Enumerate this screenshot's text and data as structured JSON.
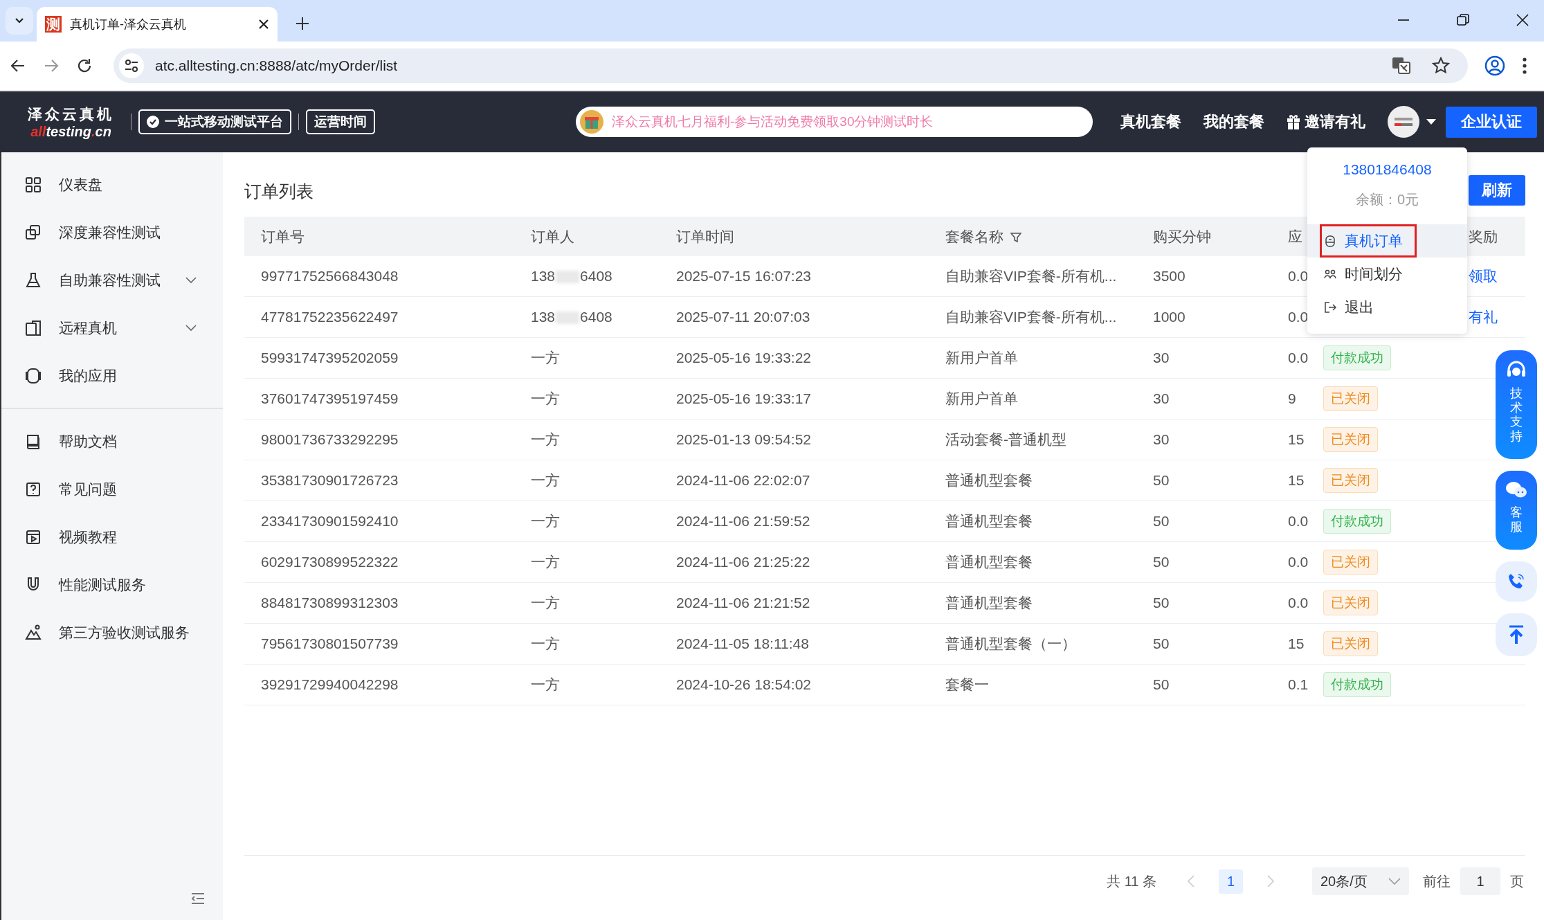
{
  "browser": {
    "tab": {
      "favicon_text": "测",
      "title": "真机订单-泽众云真机"
    },
    "url": "atc.alltesting.cn:8888/atc/myOrder/list"
  },
  "header": {
    "logo_name": "泽众云真机",
    "logo_domain": [
      {
        "text": "all",
        "color": "#e8312a"
      },
      {
        "text": "testing",
        "color": "#ffffff"
      },
      {
        "text": ".",
        "color": "#e8312a"
      },
      {
        "text": "cn",
        "color": "#ffffff"
      }
    ],
    "badges": [
      {
        "label": "一站式移动测试平台",
        "kind": "check"
      },
      {
        "label": "运营时间",
        "kind": "plain"
      }
    ],
    "announcement": "泽众云真机七月福利-参与活动免费领取30分钟测试时长",
    "nav": [
      {
        "label": "真机套餐",
        "kind": "text"
      },
      {
        "label": "我的套餐",
        "kind": "text"
      },
      {
        "label": "邀请有礼",
        "kind": "gift"
      }
    ],
    "cert_button": "企业认证"
  },
  "sidebar": {
    "groups": [
      [
        {
          "label": "仪表盘"
        },
        {
          "label": "深度兼容性测试"
        },
        {
          "label": "自助兼容性测试",
          "expanded": false
        },
        {
          "label": "远程真机",
          "expanded": false
        },
        {
          "label": "我的应用"
        }
      ],
      [
        {
          "label": "帮助文档"
        },
        {
          "label": "常见问题"
        },
        {
          "label": "视频教程"
        },
        {
          "label": "性能测试服务"
        },
        {
          "label": "第三方验收测试服务"
        }
      ]
    ]
  },
  "page": {
    "title": "订单列表",
    "refresh_button": "刷新"
  },
  "table": {
    "columns": [
      {
        "label": "订单号"
      },
      {
        "label": "订单人"
      },
      {
        "label": "订单时间"
      },
      {
        "label": "套餐名称",
        "filter": true
      },
      {
        "label": "购买分钟"
      },
      {
        "label": "应"
      },
      {
        "label": "奖励"
      }
    ],
    "rows": [
      {
        "order_no": "99771752566843048",
        "orderer": [
          "138",
          "6408"
        ],
        "time": "2025-07-15 16:07:23",
        "package": "自助兼容VIP套餐-所有机...",
        "minutes": "3500",
        "amount": "0.0",
        "reward": "领取"
      },
      {
        "order_no": "47781752235622497",
        "orderer": [
          "138",
          "6408"
        ],
        "time": "2025-07-11 20:07:03",
        "package": "自助兼容VIP套餐-所有机...",
        "minutes": "1000",
        "amount": "0.0",
        "reward": "有礼"
      },
      {
        "order_no": "59931747395202059",
        "orderer": [
          "一方"
        ],
        "time": "2025-05-16 19:33:22",
        "package": "新用户首单",
        "minutes": "30",
        "amount": "0.0",
        "status": {
          "text": "付款成功",
          "kind": "paid"
        }
      },
      {
        "order_no": "37601747395197459",
        "orderer": [
          "一方"
        ],
        "time": "2025-05-16 19:33:17",
        "package": "新用户首单",
        "minutes": "30",
        "amount": "9",
        "status": {
          "text": "已关闭",
          "kind": "closed"
        }
      },
      {
        "order_no": "98001736733292295",
        "orderer": [
          "一方"
        ],
        "time": "2025-01-13 09:54:52",
        "package": "活动套餐-普通机型",
        "minutes": "30",
        "amount": "15",
        "status": {
          "text": "已关闭",
          "kind": "closed"
        }
      },
      {
        "order_no": "35381730901726723",
        "orderer": [
          "一方"
        ],
        "time": "2024-11-06 22:02:07",
        "package": "普通机型套餐",
        "minutes": "50",
        "amount": "15",
        "status": {
          "text": "已关闭",
          "kind": "closed"
        }
      },
      {
        "order_no": "23341730901592410",
        "orderer": [
          "一方"
        ],
        "time": "2024-11-06 21:59:52",
        "package": "普通机型套餐",
        "minutes": "50",
        "amount": "0.0",
        "status": {
          "text": "付款成功",
          "kind": "paid"
        }
      },
      {
        "order_no": "60291730899522322",
        "orderer": [
          "一方"
        ],
        "time": "2024-11-06 21:25:22",
        "package": "普通机型套餐",
        "minutes": "50",
        "amount": "0.0",
        "status": {
          "text": "已关闭",
          "kind": "closed"
        }
      },
      {
        "order_no": "88481730899312303",
        "orderer": [
          "一方"
        ],
        "time": "2024-11-06 21:21:52",
        "package": "普通机型套餐",
        "minutes": "50",
        "amount": "0.0",
        "status": {
          "text": "已关闭",
          "kind": "closed"
        }
      },
      {
        "order_no": "79561730801507739",
        "orderer": [
          "一方"
        ],
        "time": "2024-11-05 18:11:48",
        "package": "普通机型套餐（一）",
        "minutes": "50",
        "amount": "15",
        "status": {
          "text": "已关闭",
          "kind": "closed"
        }
      },
      {
        "order_no": "39291729940042298",
        "orderer": [
          "一方"
        ],
        "time": "2024-10-26 18:54:02",
        "package": "套餐一",
        "minutes": "50",
        "amount": "0.1",
        "status": {
          "text": "付款成功",
          "kind": "paid"
        }
      }
    ]
  },
  "pagination": {
    "total": "共 11 条",
    "prev_disabled": true,
    "pages": [
      {
        "label": "1",
        "selected": true
      }
    ],
    "next_disabled": true,
    "page_size": "20条/页",
    "goto_label": "前往",
    "goto_value": "1",
    "goto_suffix": "页"
  },
  "user_menu": {
    "phone": "13801846408",
    "balance": "余额：0元",
    "items": [
      {
        "label": "真机订单",
        "selected": true,
        "outlined": true
      },
      {
        "label": "时间划分",
        "selected": false,
        "outlined": false
      },
      {
        "label": "退出",
        "selected": false,
        "outlined": false
      }
    ]
  },
  "float_tools": {
    "support": "技术支持",
    "service": "客服"
  }
}
